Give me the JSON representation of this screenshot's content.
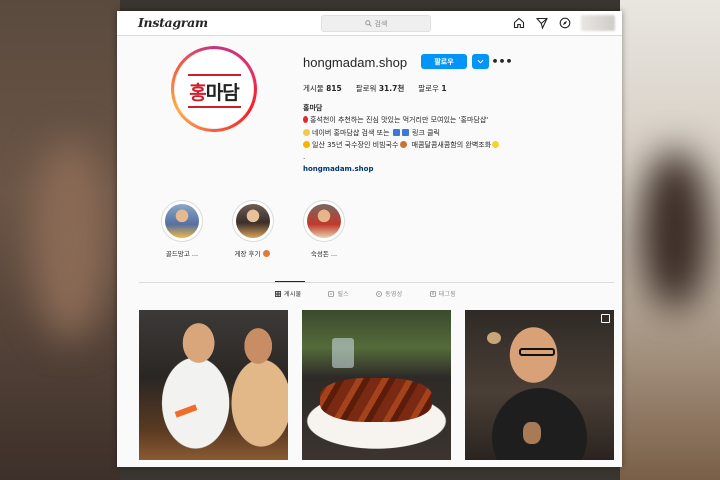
{
  "topbar": {
    "logo": "Instagram",
    "search_placeholder": "검색",
    "icons": [
      "home-icon",
      "send-icon",
      "explore-icon"
    ]
  },
  "profile": {
    "username": "hongmadam.shop",
    "follow_label": "팔로우",
    "brand_text_red": "홍",
    "brand_text_black": "마담",
    "stats": [
      {
        "label": "게시물",
        "value": "815"
      },
      {
        "label": "팔로워",
        "value": "31.7천"
      },
      {
        "label": "팔로우",
        "value": "1"
      }
    ],
    "bio_name": "홍마담",
    "bio_lines": [
      "홍석천이 추천하는 진심 맛있는 먹거리만 모여있는 '홍마담샵'",
      "네이버 홍마담샵 검색 또는",
      "링크 클릭",
      "일산 35년 국수장인 비빔국수",
      "매콤달콤새콤함의 완벽조화"
    ],
    "bio_dot": ".",
    "bio_link": "hongmadam.shop"
  },
  "highlights": [
    {
      "label": "골드망고 ..."
    },
    {
      "label": "게장 후기"
    },
    {
      "label": "숙성돈 ..."
    }
  ],
  "tabs": [
    {
      "label": "게시물",
      "icon": "grid-icon",
      "active": true
    },
    {
      "label": "릴스",
      "icon": "reels-icon",
      "active": false
    },
    {
      "label": "동영상",
      "icon": "video-icon",
      "active": false
    },
    {
      "label": "태그됨",
      "icon": "tag-icon",
      "active": false
    }
  ],
  "colors": {
    "follow_blue": "#0095f6",
    "brand_red": "#d01f2a",
    "link_blue": "#00376b"
  }
}
